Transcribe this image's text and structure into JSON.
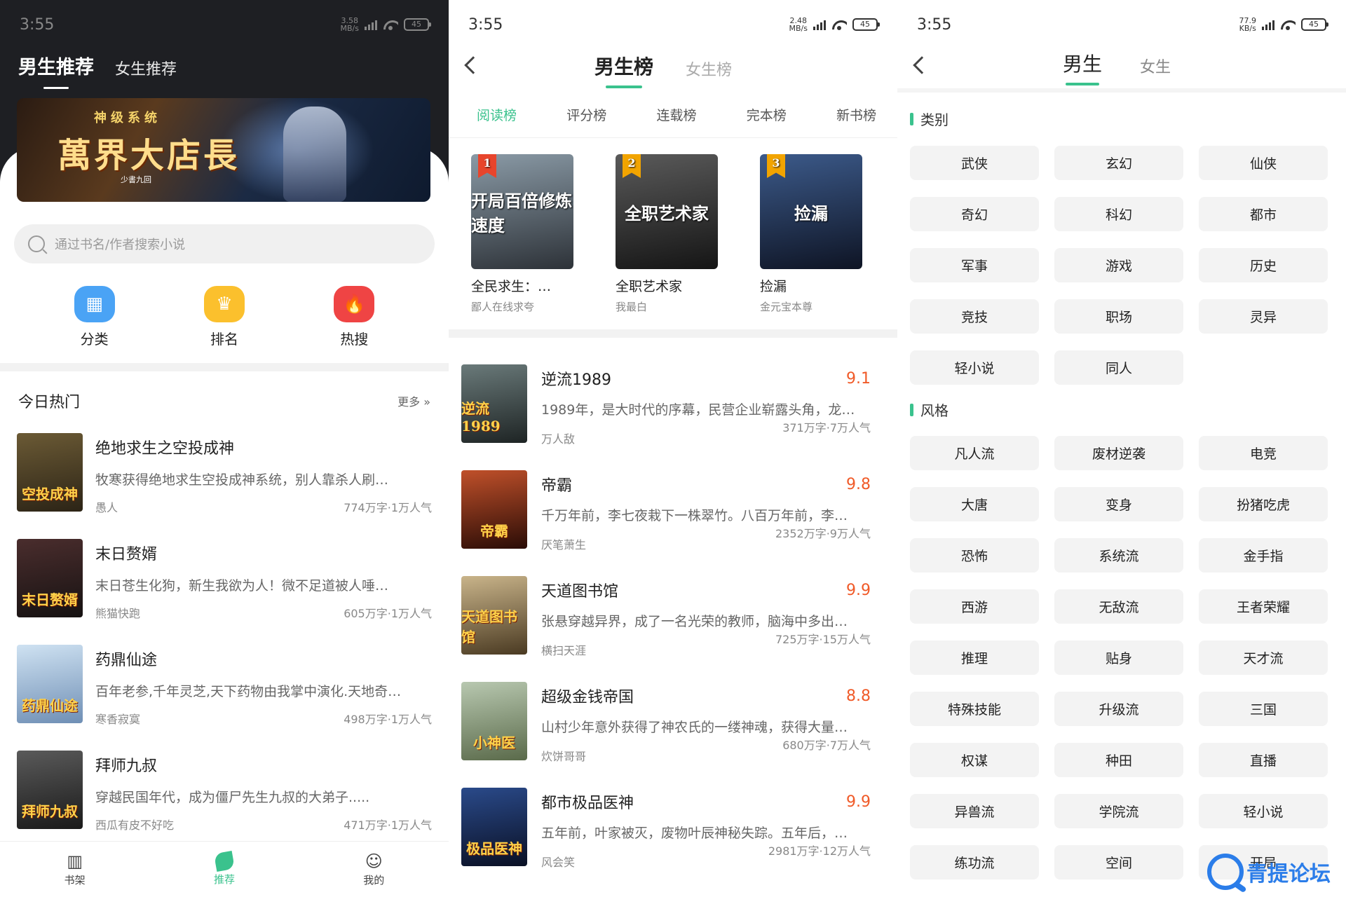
{
  "screen1": {
    "status": {
      "time": "3:55",
      "net_top": "3.58",
      "net_bottom": "MB/s",
      "battery": "45"
    },
    "tabs": {
      "active": "男生推荐",
      "inactive": "女生推荐"
    },
    "banner": {
      "tag": "神级系统",
      "title": "萬界大店長",
      "author": "少書九回"
    },
    "search": {
      "placeholder": "通过书名/作者搜索小说"
    },
    "shortcuts": [
      {
        "label": "分类",
        "icon": "category-icon",
        "glyph": "▦"
      },
      {
        "label": "排名",
        "icon": "crown-icon",
        "glyph": "♛"
      },
      {
        "label": "热搜",
        "icon": "flame-icon",
        "glyph": "🔥"
      }
    ],
    "section": {
      "title": "今日热门",
      "more": "更多 »"
    },
    "books": [
      {
        "title": "绝地求生之空投成神",
        "desc": "牧寒获得绝地求生空投成神系统，别人靠杀人刷…",
        "author": "愚人",
        "stats": "774万字·1万人气",
        "cover_text": "空投成神",
        "cover_colors": [
          "#6b5a35",
          "#2c2416"
        ]
      },
      {
        "title": "末日赘婿",
        "desc": "末日苍生化狗，新生我欲为人！微不足道被人唾…",
        "author": "熊猫快跑",
        "stats": "605万字·1万人气",
        "cover_text": "末日赘婿",
        "cover_colors": [
          "#4a2d2d",
          "#161212"
        ]
      },
      {
        "title": "药鼎仙途",
        "desc": "百年老参,千年灵芝,天下药物由我掌中演化.天地奇…",
        "author": "寒香寂寞",
        "stats": "498万字·1万人气",
        "cover_text": "药鼎仙途",
        "cover_colors": [
          "#cfe2f2",
          "#6f8fb5"
        ]
      },
      {
        "title": "拜师九叔",
        "desc": "穿越民国年代，成为僵尸先生九叔的大弟子.....",
        "author": "西瓜有皮不好吃",
        "stats": "471万字·1万人气",
        "cover_text": "拜师九叔",
        "cover_colors": [
          "#5a5a5a",
          "#1a1a1a"
        ]
      }
    ],
    "nav": [
      {
        "label": "书架",
        "icon": "bookshelf-icon",
        "active": false
      },
      {
        "label": "推荐",
        "icon": "leaf-icon",
        "active": true
      },
      {
        "label": "我的",
        "icon": "profile-icon",
        "active": false
      }
    ]
  },
  "screen2": {
    "status": {
      "time": "3:55",
      "net_top": "2.48",
      "net_bottom": "MB/s",
      "battery": "45"
    },
    "tabs": {
      "active": "男生榜",
      "inactive": "女生榜"
    },
    "sub_tabs": [
      "阅读榜",
      "评分榜",
      "连载榜",
      "完本榜",
      "新书榜"
    ],
    "top3": [
      {
        "rank": "1",
        "title": "全民求生：…",
        "author": "鄙人在线求夸",
        "cover_text": "开局百倍修炼速度",
        "flag_color": "#e8452c",
        "cover_colors": [
          "#8a9aa6",
          "#2d3238"
        ]
      },
      {
        "rank": "2",
        "title": "全职艺术家",
        "author": "我最白",
        "cover_text": "全职艺术家",
        "flag_color": "#f2a400",
        "cover_colors": [
          "#5a5a5a",
          "#151515"
        ]
      },
      {
        "rank": "3",
        "title": "捡漏",
        "author": "金元宝本尊",
        "cover_text": "捡漏",
        "flag_color": "#f2a400",
        "cover_colors": [
          "#3c5a8a",
          "#0e1424"
        ]
      }
    ],
    "list": [
      {
        "title": "逆流1989",
        "score": "9.1",
        "desc": "1989年，是大时代的序幕，民营企业崭露头角，龙…",
        "author": "万人敌",
        "stats": "371万字·7万人气",
        "cover_text": "逆流1989",
        "cover_colors": [
          "#6a7a7a",
          "#1e2424"
        ]
      },
      {
        "title": "帝霸",
        "score": "9.8",
        "desc": "千万年前，李七夜栽下一株翠竹。八百万年前，李…",
        "author": "厌笔萧生",
        "stats": "2352万字·9万人气",
        "cover_text": "帝霸",
        "cover_colors": [
          "#c0502a",
          "#2a0c06"
        ]
      },
      {
        "title": "天道图书馆",
        "score": "9.9",
        "desc": "张悬穿越异界，成了一名光荣的教师，脑海中多出…",
        "author": "横扫天涯",
        "stats": "725万字·15万人气",
        "cover_text": "天道图书馆",
        "cover_colors": [
          "#c9b48a",
          "#4a3a22"
        ]
      },
      {
        "title": "超级金钱帝国",
        "score": "8.8",
        "desc": "山村少年意外获得了神农氏的一缕神魂，获得大量…",
        "author": "炊饼哥哥",
        "stats": "680万字·7万人气",
        "cover_text": "小神医",
        "cover_colors": [
          "#b8c8b0",
          "#5a6a4a"
        ]
      },
      {
        "title": "都市极品医神",
        "score": "9.9",
        "desc": "五年前，叶家被灭，废物叶辰神秘失踪。五年后，…",
        "author": "风会笑",
        "stats": "2981万字·12万人气",
        "cover_text": "极品医神",
        "cover_colors": [
          "#2a4a8a",
          "#0a1024"
        ]
      }
    ]
  },
  "screen3": {
    "status": {
      "time": "3:55",
      "net_top": "77.9",
      "net_bottom": "KB/s",
      "battery": "45"
    },
    "tabs": {
      "active": "男生",
      "inactive": "女生"
    },
    "groups": [
      {
        "title": "类别",
        "items": [
          "武侠",
          "玄幻",
          "仙侠",
          "奇幻",
          "科幻",
          "都市",
          "军事",
          "游戏",
          "历史",
          "竞技",
          "职场",
          "灵异",
          "轻小说",
          "同人"
        ]
      },
      {
        "title": "风格",
        "items": [
          "凡人流",
          "废材逆袭",
          "电竞",
          "大唐",
          "变身",
          "扮猪吃虎",
          "恐怖",
          "系统流",
          "金手指",
          "西游",
          "无敌流",
          "王者荣耀",
          "推理",
          "贴身",
          "天才流",
          "特殊技能",
          "升级流",
          "三国",
          "权谋",
          "种田",
          "直播",
          "异兽流",
          "学院流",
          "轻小说",
          "练功流",
          "空间",
          "开局"
        ]
      }
    ],
    "watermark": "青提论坛"
  }
}
